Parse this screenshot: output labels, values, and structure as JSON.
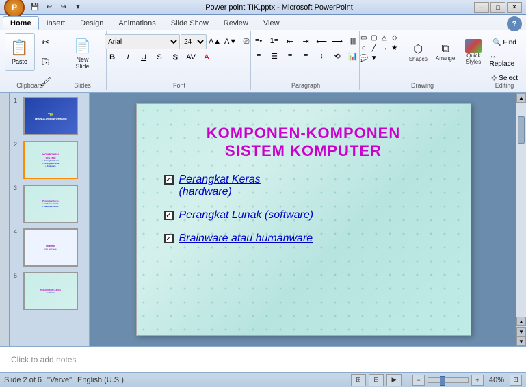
{
  "window": {
    "title": "Power point TIK.pptx - Microsoft PowerPoint",
    "controls": [
      "─",
      "□",
      "✕"
    ]
  },
  "tabs": {
    "items": [
      "Home",
      "Insert",
      "Design",
      "Animations",
      "Slide Show",
      "Review",
      "View"
    ],
    "active": "Home"
  },
  "ribbon": {
    "groups": {
      "clipboard": {
        "label": "Clipboard",
        "paste_label": "Paste",
        "items": [
          "Cut",
          "Copy",
          "Format Painter"
        ]
      },
      "slides": {
        "label": "Slides",
        "items": [
          "New Slide"
        ]
      },
      "font": {
        "label": "Font",
        "font_name": "Arial",
        "font_size": "24",
        "bold": "B",
        "italic": "I",
        "underline": "U",
        "strikethrough": "S",
        "shadow": "S",
        "format": "Aa"
      },
      "paragraph": {
        "label": "Paragraph"
      },
      "drawing": {
        "label": "Drawing",
        "shapes_label": "Shapes",
        "arrange_label": "Arrange",
        "quick_styles_label": "Quick Styles",
        "quick_styles": "Quick\nStyles"
      },
      "editing": {
        "label": "Editing"
      }
    }
  },
  "slides": {
    "total": 6,
    "current": 2,
    "items": [
      {
        "num": 1,
        "label": "Slide 1"
      },
      {
        "num": 2,
        "label": "Slide 2",
        "active": true
      },
      {
        "num": 3,
        "label": "Slide 3"
      },
      {
        "num": 4,
        "label": "Slide 4"
      },
      {
        "num": 5,
        "label": "Slide 5"
      }
    ]
  },
  "slide_content": {
    "title_line1": "KOMPONEN-KOMPONEN",
    "title_line2": "SISTEM KOMPUTER",
    "bullets": [
      {
        "text": "Perangkat Keras (hardware)"
      },
      {
        "text": "Perangkat Lunak (software)"
      },
      {
        "text": "Brainware atau humanware"
      }
    ]
  },
  "notes": {
    "placeholder": "Click to add notes"
  },
  "status": {
    "slide_info": "Slide 2 of 6",
    "theme": "\"Verve\"",
    "language": "English (U.S.)",
    "zoom": "40%",
    "view_buttons": [
      "normal",
      "slide-sorter",
      "slide-show"
    ]
  },
  "help": "?"
}
